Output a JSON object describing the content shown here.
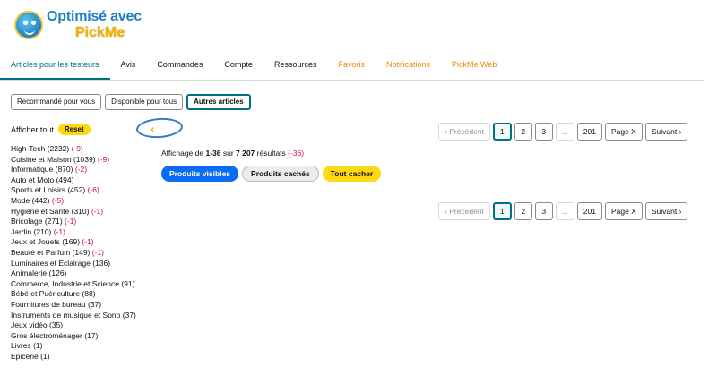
{
  "logo": {
    "line1": "Optimisé avec",
    "line2": "PickMe"
  },
  "tabs": [
    {
      "label": "Articles pour les testeurs",
      "state": "active"
    },
    {
      "label": "Avis",
      "state": ""
    },
    {
      "label": "Commandes",
      "state": ""
    },
    {
      "label": "Compte",
      "state": ""
    },
    {
      "label": "Ressources",
      "state": ""
    },
    {
      "label": "Favoris",
      "state": "orange"
    },
    {
      "label": "Notifications",
      "state": "orange"
    },
    {
      "label": "PickMe Web",
      "state": "orange"
    }
  ],
  "filters": [
    {
      "label": "Recommandé pour vous",
      "active": false
    },
    {
      "label": "Disponible pour tous",
      "active": false
    },
    {
      "label": "Autres articles",
      "active": true
    }
  ],
  "sidebar": {
    "show_all": "Afficher tout",
    "reset": "Reset",
    "categories": [
      {
        "name": "High-Tech",
        "count": "(2232)",
        "delta": "(-9)"
      },
      {
        "name": "Cuisine et Maison",
        "count": "(1039)",
        "delta": "(-9)"
      },
      {
        "name": "Informatique",
        "count": "(870)",
        "delta": "(-2)"
      },
      {
        "name": "Auto et Moto",
        "count": "(494)",
        "delta": ""
      },
      {
        "name": "Sports et Loisirs",
        "count": "(452)",
        "delta": "(-6)"
      },
      {
        "name": "Mode",
        "count": "(442)",
        "delta": "(-5)"
      },
      {
        "name": "Hygiène et Santé",
        "count": "(310)",
        "delta": "(-1)"
      },
      {
        "name": "Bricolage",
        "count": "(271)",
        "delta": "(-1)"
      },
      {
        "name": "Jardin",
        "count": "(210)",
        "delta": "(-1)"
      },
      {
        "name": "Jeux et Jouets",
        "count": "(169)",
        "delta": "(-1)"
      },
      {
        "name": "Beauté et Parfum",
        "count": "(149)",
        "delta": "(-1)"
      },
      {
        "name": "Luminaires et Éclairage",
        "count": "(136)",
        "delta": ""
      },
      {
        "name": "Animalerie",
        "count": "(126)",
        "delta": ""
      },
      {
        "name": "Commerce, Industrie et Science",
        "count": "(91)",
        "delta": ""
      },
      {
        "name": "Bébé et Puériculture",
        "count": "(88)",
        "delta": ""
      },
      {
        "name": "Fournitures de bureau",
        "count": "(37)",
        "delta": ""
      },
      {
        "name": "Instruments de musique et Sono",
        "count": "(37)",
        "delta": ""
      },
      {
        "name": "Jeux vidéo",
        "count": "(35)",
        "delta": ""
      },
      {
        "name": "Gros électroménager",
        "count": "(17)",
        "delta": ""
      },
      {
        "name": "Livres",
        "count": "(1)",
        "delta": ""
      },
      {
        "name": "Epicerie",
        "count": "(1)",
        "delta": ""
      }
    ]
  },
  "collapse_glyph": "‹",
  "results": {
    "prefix": "Affichage de ",
    "range": "1-36",
    "middle": " sur ",
    "total": "7 207",
    "suffix": " résultats ",
    "delta": "(-36)"
  },
  "view_buttons": {
    "visible": "Produits visibles",
    "hidden": "Produits cachés",
    "hide_all": "Tout cacher"
  },
  "pagination": {
    "prev": "‹ Précédent",
    "pages": [
      "1",
      "2",
      "3",
      "...",
      "201"
    ],
    "active_page": "1",
    "page_x": "Page X",
    "next": "Suivant ›"
  },
  "colors": {
    "accent": "#007185",
    "orange": "#f08804",
    "negative": "#cc0c39",
    "yellow": "#ffd814",
    "blue": "#0a6cf5"
  }
}
